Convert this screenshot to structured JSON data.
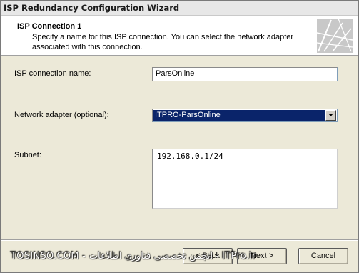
{
  "window": {
    "title": "ISP Redundancy Configuration Wizard"
  },
  "header": {
    "title": "ISP Connection 1",
    "description": "Specify a name for this ISP connection. You can select the network adapter associated with this connection."
  },
  "form": {
    "connection_name_label": "ISP connection name:",
    "connection_name_value": "ParsOnline",
    "adapter_label": "Network adapter (optional):",
    "adapter_value": "ITPRO-ParsOnline",
    "subnet_label": "Subnet:",
    "subnet_items": [
      "192.168.0.1/24"
    ]
  },
  "buttons": {
    "back": "< Back",
    "next": "Next >",
    "cancel": "Cancel"
  },
  "watermark": {
    "text": "TOSINSO.COM - انجمن تخصصی فناوری اطلاعات - ITPro.ir"
  },
  "colors": {
    "selection": "#0a246a",
    "dialog_bg": "#ece9d8"
  }
}
